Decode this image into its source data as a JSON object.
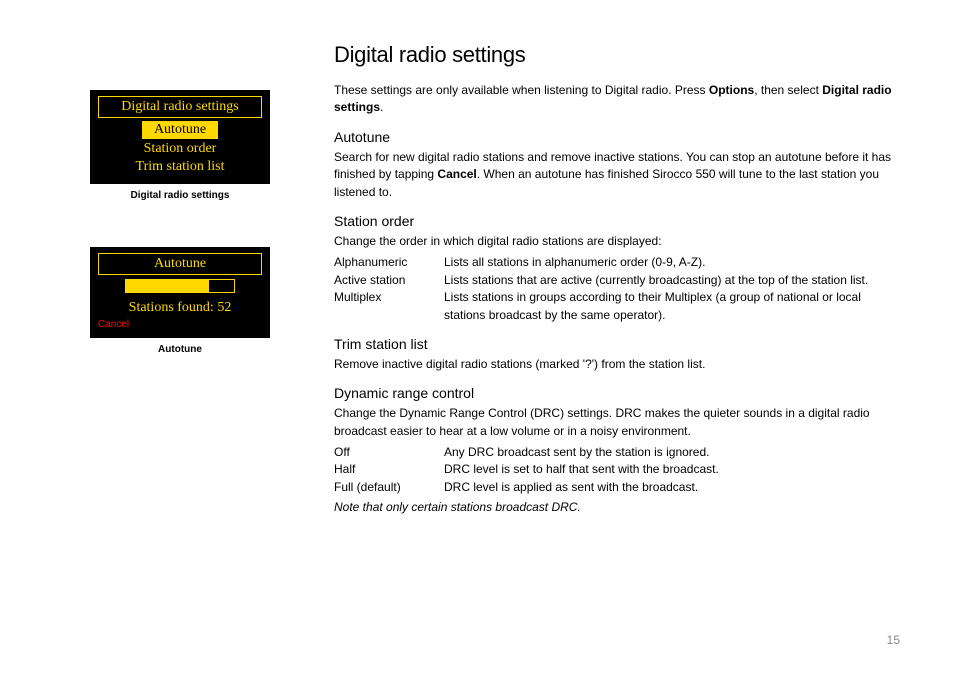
{
  "screens": {
    "s1": {
      "title": "Digital radio settings",
      "item_selected": "Autotune",
      "item2": "Station order",
      "item3": "Trim station list",
      "caption": "Digital radio settings"
    },
    "s2": {
      "title": "Autotune",
      "found": "Stations found: 52",
      "cancel": "Cancel",
      "caption": "Autotune"
    }
  },
  "main": {
    "heading": "Digital radio settings",
    "intro_a": "These settings are only available when listening to Digital radio. Press ",
    "intro_b": "Options",
    "intro_c": ", then select ",
    "intro_d": "Digital radio settings",
    "intro_e": ".",
    "sec1": {
      "h": "Autotune",
      "p_a": "Search for new digital radio stations and remove inactive stations. You can stop an autotune before it has finished by tapping ",
      "p_b": "Cancel",
      "p_c": ". When an autotune has finished Sirocco 550 will tune to the last station you listened to."
    },
    "sec2": {
      "h": "Station order",
      "p": "Change the order in which digital radio stations are displayed:",
      "d1t": "Alphanumeric",
      "d1d": "Lists all stations in alphanumeric order (0-9, A-Z).",
      "d2t": "Active station",
      "d2d": "Lists stations that are active (currently broadcasting) at the top of the station list.",
      "d3t": "Multiplex",
      "d3d": "Lists stations in groups according to their Multiplex (a group of national or local stations broadcast by the same operator)."
    },
    "sec3": {
      "h": "Trim station list",
      "p": "Remove inactive digital radio stations (marked '?') from the station list."
    },
    "sec4": {
      "h": "Dynamic range control",
      "p": "Change the Dynamic Range Control (DRC) settings. DRC makes the quieter sounds in a digital radio broadcast easier to hear at a low volume or in a noisy environment.",
      "d1t": "Off",
      "d1d": "Any DRC broadcast sent by the station is ignored.",
      "d2t": "Half",
      "d2d": "DRC level is set to half that sent with the broadcast.",
      "d3t": "Full (default)",
      "d3d": "DRC level is applied as sent with the broadcast.",
      "note": "Note that only certain stations broadcast DRC."
    }
  },
  "page_number": "15"
}
